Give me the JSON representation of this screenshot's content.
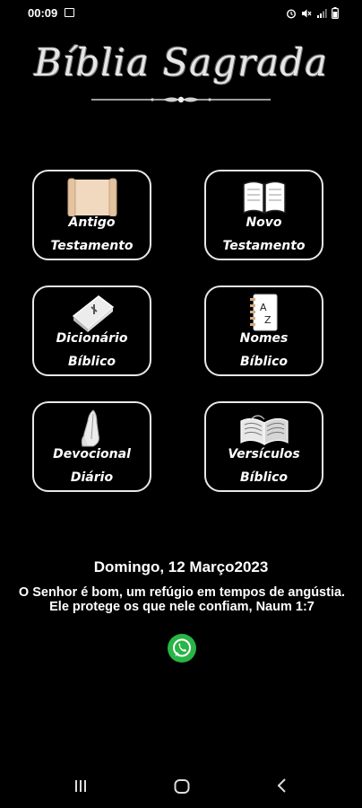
{
  "status_bar": {
    "time": "00:09",
    "icons": [
      "image-icon",
      "alarm-icon",
      "mute-icon",
      "signal-icon",
      "battery-icon"
    ]
  },
  "app": {
    "title": "Bíblia Sagrada"
  },
  "menu": [
    {
      "line1": "Antigo",
      "line2": "Testamento",
      "icon": "scroll-icon"
    },
    {
      "line1": "Novo",
      "line2": "Testamento",
      "icon": "open-book-icon"
    },
    {
      "line1": "Dicionário",
      "line2": "Bíblico",
      "icon": "closed-bible-icon"
    },
    {
      "line1": "Nomes",
      "line2": "Bíblico",
      "icon": "address-book-icon"
    },
    {
      "line1": "Devocional",
      "line2": "Diário",
      "icon": "praying-hands-icon"
    },
    {
      "line1": "Versículos",
      "line2": "Bíblico",
      "icon": "open-bible-icon"
    }
  ],
  "daily": {
    "date": "Domingo, 12 Março2023",
    "verse": "O Senhor é bom, um refúgio em tempos de angústia. Ele protege os que nele confiam, Naum 1:7"
  },
  "share_icon": "whatsapp-icon",
  "nav_icons": [
    "recents-icon",
    "home-icon",
    "back-icon"
  ],
  "colors": {
    "background": "#000000",
    "tile_border": "#e8e8e8",
    "scroll_parchment": "#f0d9be",
    "whatsapp": "#29b446"
  }
}
